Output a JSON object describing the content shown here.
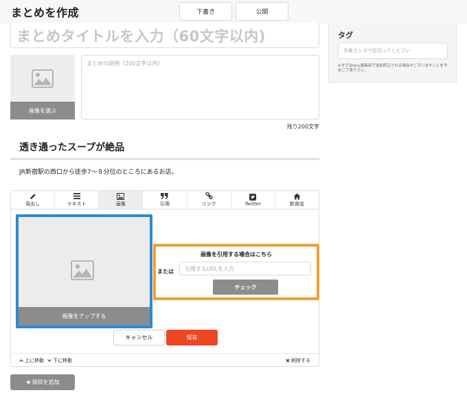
{
  "header": {
    "title": "まとめを作成",
    "draft_label": "下書き",
    "publish_label": "公開"
  },
  "matome": {
    "title_placeholder": "まとめタイトルを入力（60文字以内)",
    "image_button_label": "画像を選ぶ",
    "description_placeholder": "まとめの説明（200文字以内）",
    "remaining_text": "残り200文字"
  },
  "content": {
    "heading": "透き通ったスープが絶品",
    "text": "JR新宿駅の西口から徒歩7～８分位のところにあるお店。"
  },
  "editor": {
    "tabs": [
      {
        "label": "見出し",
        "icon": "pencil-icon"
      },
      {
        "label": "テキスト",
        "icon": "lines-icon"
      },
      {
        "label": "画像",
        "icon": "image-icon",
        "active": true
      },
      {
        "label": "引用",
        "icon": "quote-icon"
      },
      {
        "label": "リンク",
        "icon": "link-icon"
      },
      {
        "label": "Twitter",
        "icon": "twitter-icon"
      },
      {
        "label": "飲食店",
        "icon": "home-icon"
      }
    ],
    "upload_label": "画像をアップする",
    "quote_label": "画像を引用する場合はこちら",
    "or_label": "または",
    "url_placeholder": "引用するURLを入力",
    "check_label": "チェック",
    "cancel_label": "キャンセル",
    "save_label": "保存",
    "move_up_label": "上に移動",
    "move_down_label": "下に移動",
    "delete_label": "削除する"
  },
  "add_item_label": "項目を追加",
  "sidebar": {
    "tag_title": "タグ",
    "tag_placeholder": "半角カンマで区切ってください",
    "tag_note": "※タグはfavy編集部で追加修正される場合がございますことを予めご了承下さい。"
  },
  "colors": {
    "upload_border": "#2a8ad8",
    "url_border": "#f0a030",
    "save": "#ee4823",
    "button_gray": "#8c8c8c"
  }
}
